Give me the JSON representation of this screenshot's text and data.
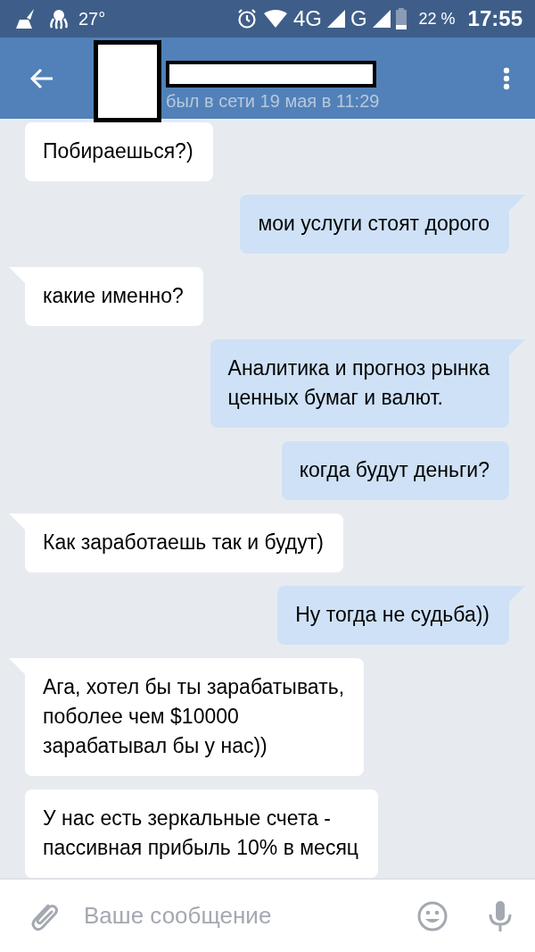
{
  "status_bar": {
    "temperature": "27°",
    "network_1": "4G",
    "network_2": "G",
    "battery": "22 %",
    "time": "17:55"
  },
  "header": {
    "last_seen": "был в сети 19 мая в 11:29"
  },
  "messages": [
    {
      "kind": "incoming",
      "tail": false,
      "text": "Побираешься?)"
    },
    {
      "kind": "outgoing",
      "tail": true,
      "text": "мои услуги стоят дорого"
    },
    {
      "kind": "incoming",
      "tail": true,
      "text": "какие именно?"
    },
    {
      "kind": "outgoing",
      "tail": true,
      "text": "Аналитика и прогноз рынка\nценных бумаг и валют."
    },
    {
      "kind": "outgoing",
      "tail": false,
      "text": "когда будут деньги?"
    },
    {
      "kind": "incoming",
      "tail": true,
      "text": "Как заработаешь так и будут)"
    },
    {
      "kind": "outgoing",
      "tail": true,
      "text": "Ну тогда не судьба))"
    },
    {
      "kind": "incoming",
      "tail": true,
      "text": "Ага, хотел бы ты зарабатывать,\nпоболее чем $10000\nзарабатывал бы у нас))"
    },
    {
      "kind": "incoming",
      "tail": false,
      "text": "У нас есть зеркальные счета -\nпассивная прибыль 10% в месяц"
    }
  ],
  "composer": {
    "placeholder": "Ваше сообщение"
  }
}
